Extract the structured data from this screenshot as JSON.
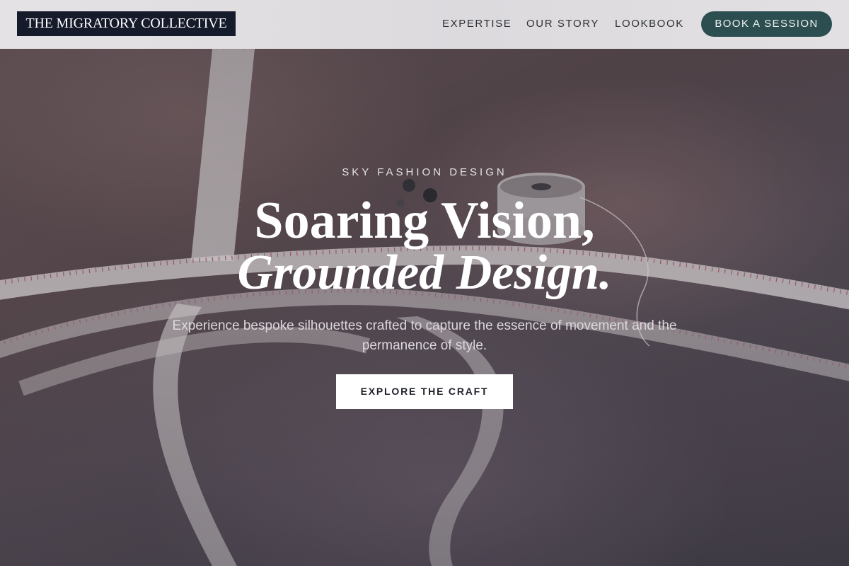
{
  "header": {
    "logo": "THE MIGRATORY COLLECTIVE",
    "nav": {
      "expertise": "EXPERTISE",
      "our_story": "OUR STORY",
      "lookbook": "LOOKBOOK"
    },
    "book_button": "BOOK A SESSION"
  },
  "hero": {
    "eyebrow": "SKY FASHION DESIGN",
    "headline_line1": "Soaring Vision,",
    "headline_line2": "Grounded Design.",
    "subtitle": "Experience bespoke silhouettes crafted to capture the essence of movement and the permanence of style.",
    "cta": "EXPLORE THE CRAFT",
    "background_image": "fabric with measuring tape, thread spool and buttons"
  },
  "colors": {
    "logo_background": "#161b2c",
    "book_button_background": "#2c4e50",
    "header_background": "#e2e0e2",
    "cta_background": "#ffffff"
  }
}
